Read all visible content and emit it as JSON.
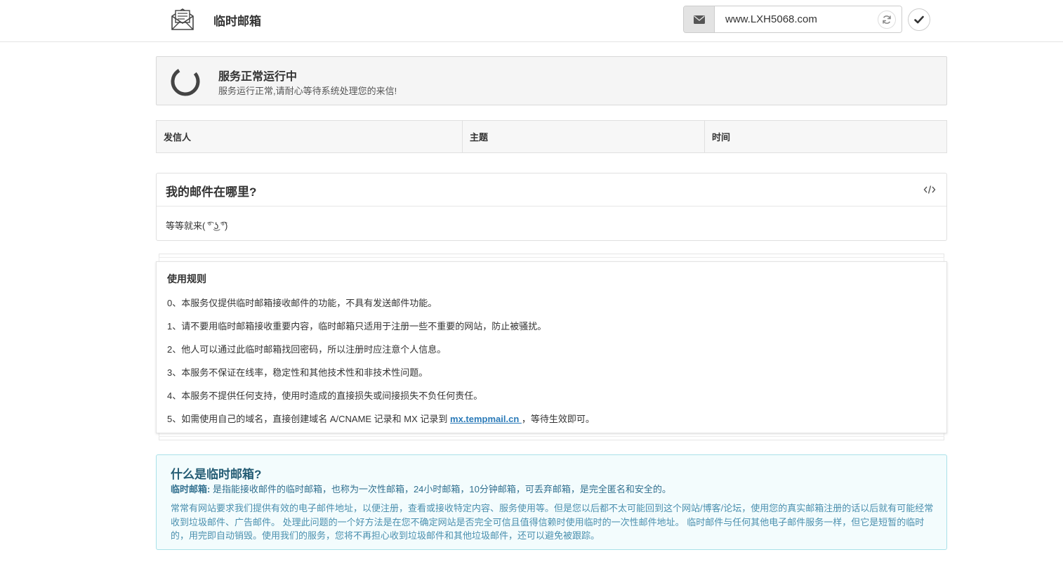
{
  "header": {
    "brand": "临时邮箱",
    "email_value": "www.LXH5068.com"
  },
  "status": {
    "title": "服务正常运行中",
    "description": "服务运行正常,请耐心等待系统处理您的来信!"
  },
  "mail_table": {
    "columns": [
      "发信人",
      "主题",
      "时间"
    ]
  },
  "faq_panel": {
    "title": "我的邮件在哪里?",
    "body": "等等就来( ͡° ͜ʖ ͡°)"
  },
  "rules": {
    "title": "使用规则",
    "items": [
      "0、本服务仅提供临时邮箱接收邮件的功能，不具有发送邮件功能。",
      "1、请不要用临时邮箱接收重要内容，临时邮箱只适用于注册一些不重要的网站，防止被骚扰。",
      "2、他人可以通过此临时邮箱找回密码，所以注册时应注意个人信息。",
      "3、本服务不保证在线率，稳定性和其他技术性和非技术性问题。",
      "4、本服务不提供任何支持，使用时造成的直接损失或间接损失不负任何责任。"
    ],
    "item5_prefix": "5、如需使用自己的域名，直接创建域名 A/CNAME 记录和 MX 记录到 ",
    "item5_link": "mx.tempmail.cn ",
    "item5_suffix": "，等待生效即可。"
  },
  "about": {
    "title": "什么是临时邮箱?",
    "lead_label": "临时邮箱:",
    "lead_text": " 是指能接收邮件的临时邮箱，也称为一次性邮箱，24小时邮箱，10分钟邮箱，可丢弃邮箱，是完全匿名和安全的。",
    "paragraph": "常常有网站要求我们提供有效的电子邮件地址，以便注册，查看或接收特定内容、服务使用等。但是您以后都不太可能回到这个网站/博客/论坛，使用您的真实邮箱注册的话以后就有可能经常收到垃圾邮件、广告邮件。 处理此问题的一个好方法是在您不确定网站是否完全可信且值得信赖时使用临时的一次性邮件地址。 临时邮件与任何其他电子邮件服务一样，但它是短暂的临时的，用完即自动销毁。使用我们的服务，您将不再担心收到垃圾邮件和其他垃圾邮件，还可以避免被跟踪。"
  },
  "colors": {
    "accent_link": "#2a7ab8",
    "info_bg": "#f3fcfd",
    "info_border": "#a9e1e8",
    "info_text": "#31708f"
  },
  "icons": {
    "logo": "envelope-letter-icon",
    "address": "envelope-icon",
    "refresh": "refresh-icon",
    "confirm": "check-icon",
    "status": "spinner-icon",
    "code": "code-icon"
  }
}
